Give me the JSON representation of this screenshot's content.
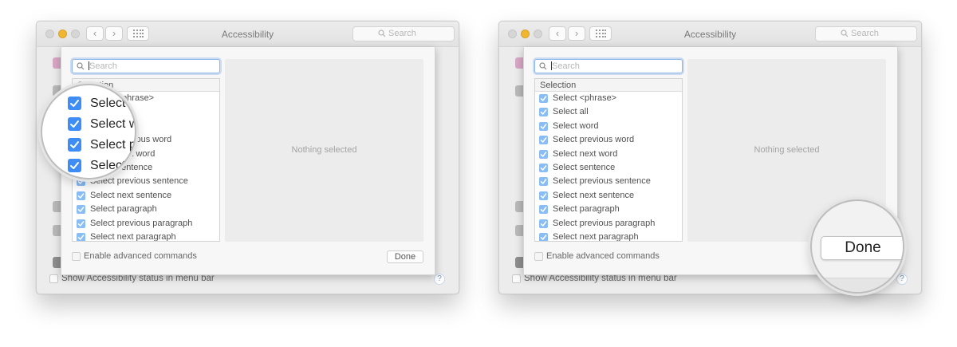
{
  "window": {
    "title": "Accessibility",
    "search_placeholder": "Search",
    "nav_back": "‹",
    "nav_forward": "›",
    "show_status_label": "Show Accessibility status in menu bar",
    "help": "?"
  },
  "sheet": {
    "search_placeholder": "Search",
    "list_header": "Selection",
    "items": [
      "Select <phrase>",
      "Select all",
      "Select word",
      "Select previous word",
      "Select next word",
      "Select sentence",
      "Select previous sentence",
      "Select next sentence",
      "Select paragraph",
      "Select previous paragraph",
      "Select next paragraph"
    ],
    "nothing_selected": "Nothing selected",
    "enable_advanced_label": "Enable advanced commands",
    "done_label": "Done"
  },
  "magnifier_left": {
    "rows": [
      "Select",
      "Select w",
      "Select p",
      "Select"
    ]
  },
  "magnifier_right": {
    "done_label": "Done"
  },
  "colors": {
    "checkbox_light": "#89bdf5",
    "checkbox_bold": "#3d8df5",
    "focus_ring": "#8fb6e8",
    "minimize_light": "#f1b630"
  }
}
